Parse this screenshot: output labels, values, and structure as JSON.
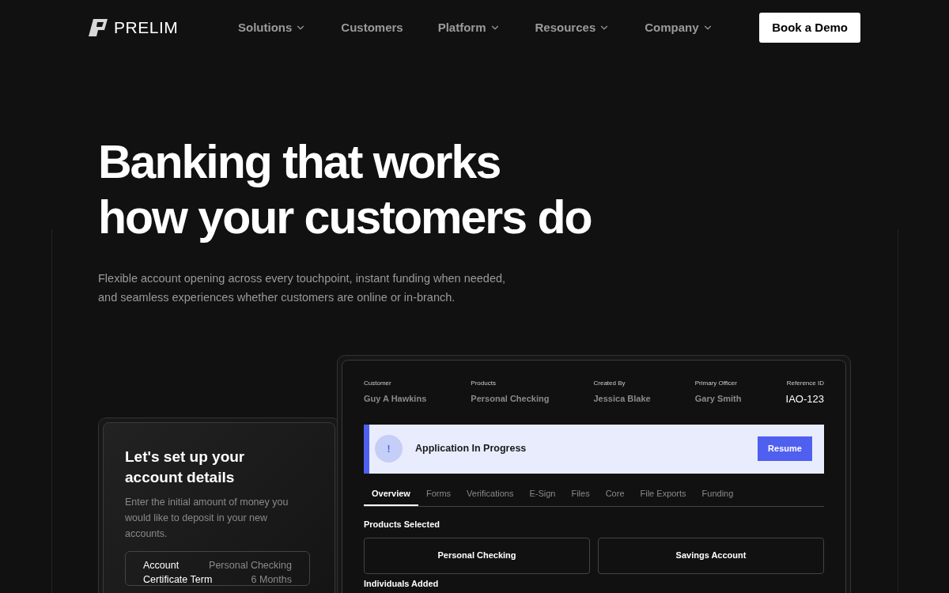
{
  "nav": {
    "logo": "PRELIM",
    "items": [
      {
        "label": "Solutions",
        "dropdown": true
      },
      {
        "label": "Customers",
        "dropdown": false
      },
      {
        "label": "Platform",
        "dropdown": true
      },
      {
        "label": "Resources",
        "dropdown": true
      },
      {
        "label": "Company",
        "dropdown": true
      }
    ],
    "cta": "Book a Demo"
  },
  "hero": {
    "heading_lines": [
      "Banking that works",
      "how your customers do"
    ],
    "subtitle_lines": [
      "Flexible account opening across every touchpoint, instant funding when needed,",
      "and seamless experiences whether customers are online or in-branch."
    ]
  },
  "account_card": {
    "title_lines": [
      "Let's set up your",
      "account details"
    ],
    "description": "Enter the initial amount of money you would like to deposit in your new accounts.",
    "rows": [
      {
        "label": "Account",
        "value": "Personal Checking"
      },
      {
        "label": "Certificate Term",
        "value": "6 Months"
      }
    ]
  },
  "application_panel": {
    "meta": [
      {
        "label": "Customer",
        "value": "Guy A Hawkins",
        "kind": "muted"
      },
      {
        "label": "Products",
        "value": "Personal Checking",
        "kind": "muted"
      },
      {
        "label": "Created By",
        "value": "Jessica Blake",
        "kind": "muted"
      },
      {
        "label": "Primary Officer",
        "value": "Gary Smith",
        "kind": "muted"
      },
      {
        "label": "Reference ID",
        "value": "IAO-123",
        "kind": "id"
      }
    ],
    "banner": {
      "icon": "!",
      "message": "Application In Progress",
      "button": "Resume"
    },
    "tabs": [
      {
        "label": "Overview",
        "selected": true
      },
      {
        "label": "Forms",
        "selected": false
      },
      {
        "label": "Verifications",
        "selected": false
      },
      {
        "label": "E-Sign",
        "selected": false
      },
      {
        "label": "Files",
        "selected": false
      },
      {
        "label": "Core",
        "selected": false
      },
      {
        "label": "File Exports",
        "selected": false
      },
      {
        "label": "Funding",
        "selected": false
      }
    ],
    "products_heading": "Products Selected",
    "products": [
      "Personal Checking",
      "Savings Account"
    ],
    "individuals_heading": "Individuals Added"
  }
}
